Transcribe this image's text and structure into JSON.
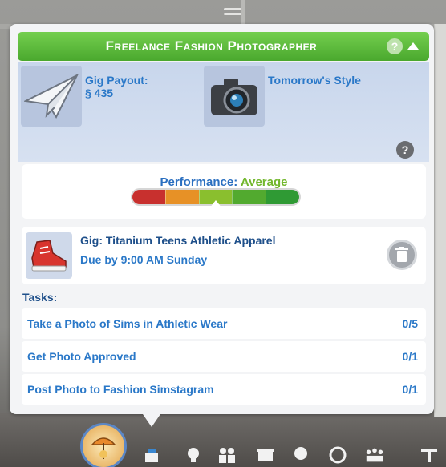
{
  "panel": {
    "title": "Freelance Fashion Photographer",
    "help_label": "?",
    "help_label_small": "?"
  },
  "payout": {
    "label": "Gig Payout:",
    "value": "§ 435"
  },
  "client": {
    "label": "Tomorrow's Style"
  },
  "performance": {
    "label": "Performance:",
    "value": "Average",
    "level_fraction": 0.5,
    "segment_colors": [
      "#c8302e",
      "#e79126",
      "#8abf2e",
      "#52aa2f",
      "#2f9a34"
    ]
  },
  "gig": {
    "title": "Gig: Titanium Teens Athletic Apparel",
    "due": "Due by 9:00  AM Sunday"
  },
  "tasks": {
    "header": "Tasks:",
    "items": [
      {
        "label": "Take a Photo of Sims in Athletic Wear",
        "progress": "0/5"
      },
      {
        "label": "Get Photo Approved",
        "progress": "0/1"
      },
      {
        "label": "Post Photo to Fashion Simstagram",
        "progress": "0/1"
      }
    ]
  },
  "colors": {
    "title_green": "#55b536",
    "link_blue": "#2a78c8",
    "average_green": "#72b72c"
  },
  "bottom_bar": {
    "icons": [
      "career-icon",
      "simology-icon",
      "skills-icon",
      "relationships-icon",
      "inventory-icon",
      "aspirations-icon",
      "emotions-icon",
      "household-icon",
      "build-icon"
    ]
  }
}
